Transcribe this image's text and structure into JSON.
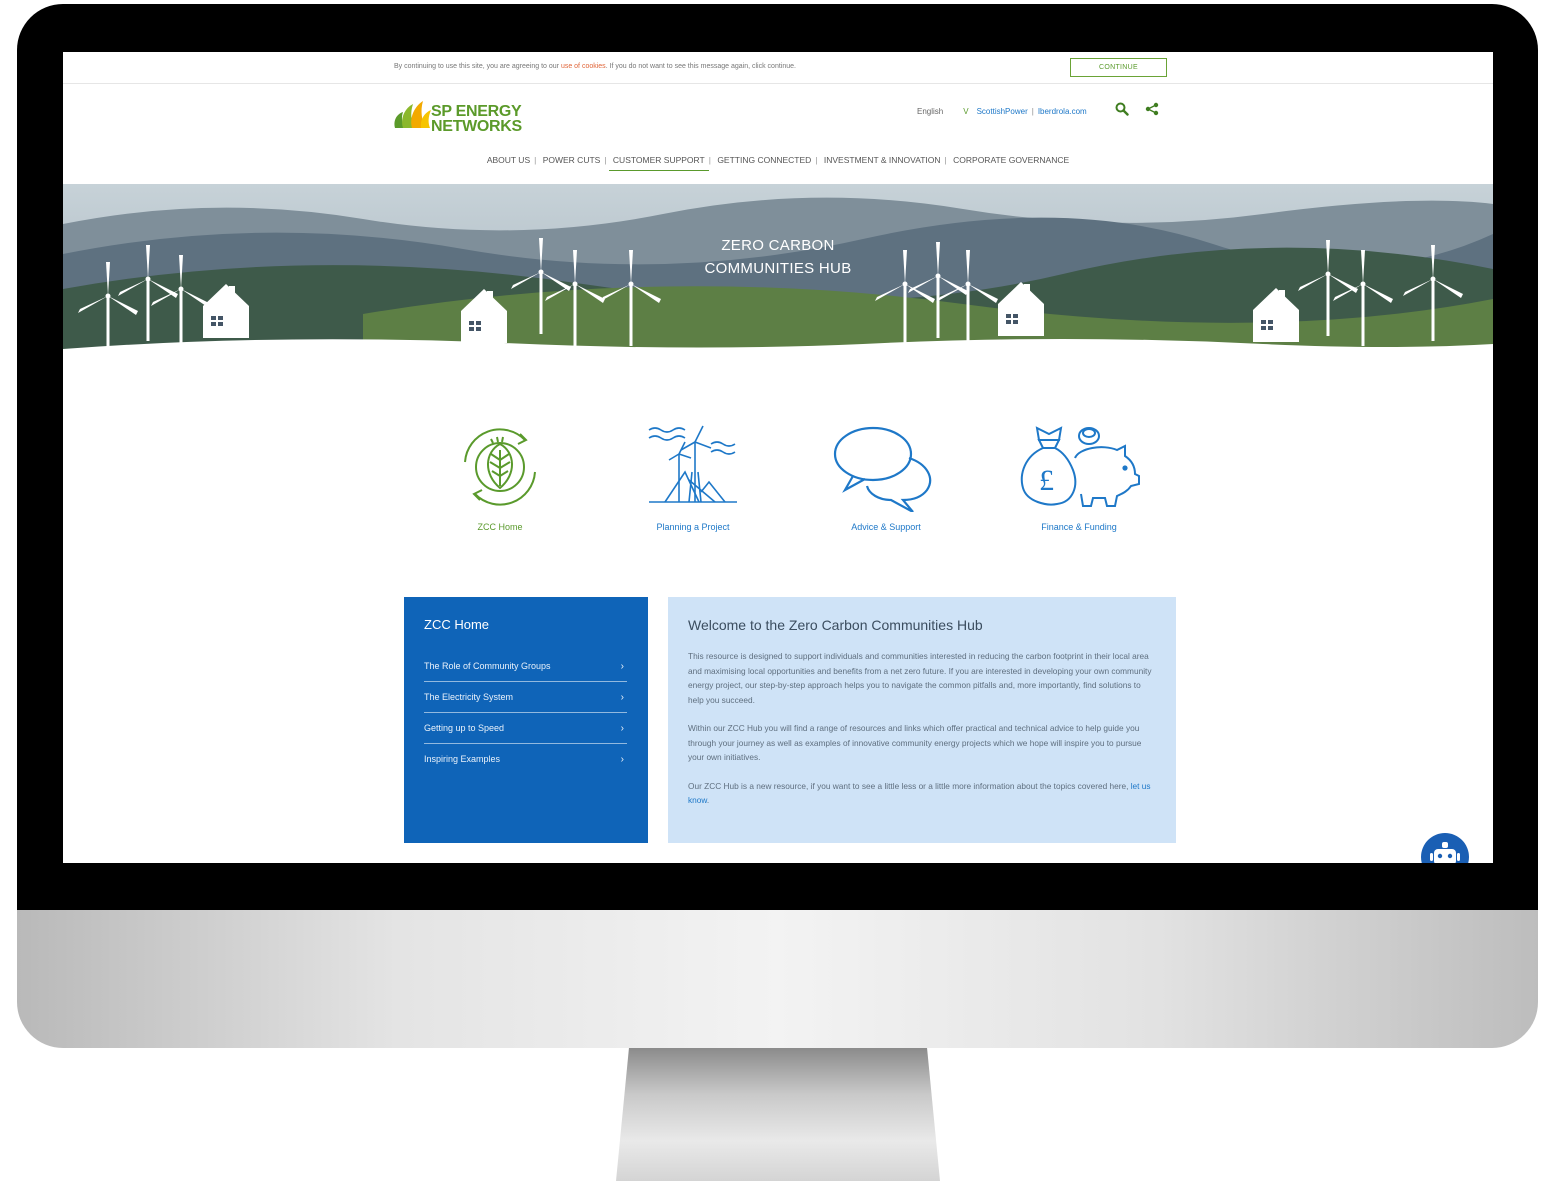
{
  "cookie_bar": {
    "text_before": "By continuing to use this site, you are agreeing to our ",
    "link_text": "use of cookies",
    "text_after": ". If you do not want to see this message again, click continue.",
    "button_label": "CONTINUE"
  },
  "header": {
    "logo_line1": "SP ENERGY",
    "logo_line2": "NETWORKS",
    "language": "English",
    "chevron": "V",
    "link1": "ScottishPower",
    "separator": "|",
    "link2": "Iberdrola.com",
    "icons": [
      "search-icon",
      "share-icon"
    ]
  },
  "nav": {
    "items": [
      {
        "label": "ABOUT US"
      },
      {
        "label": "POWER CUTS"
      },
      {
        "label": "CUSTOMER SUPPORT"
      },
      {
        "label": "GETTING CONNECTED"
      },
      {
        "label": "INVESTMENT & INNOVATION"
      },
      {
        "label": "CORPORATE GOVERNANCE"
      }
    ],
    "active": "CUSTOMER SUPPORT"
  },
  "hero": {
    "title_line1": "ZERO CARBON",
    "title_line2": "COMMUNITIES HUB"
  },
  "tiles": [
    {
      "label": "ZCC Home",
      "icon": "leaf-recycle-icon",
      "color": "#5a9a2c"
    },
    {
      "label": "Planning a Project",
      "icon": "wind-turbine-icon",
      "color": "#1e78c8"
    },
    {
      "label": "Advice & Support",
      "icon": "speech-bubbles-icon",
      "color": "#1e78c8"
    },
    {
      "label": "Finance & Funding",
      "icon": "money-bag-piggy-icon",
      "color": "#1e78c8"
    }
  ],
  "side_menu": {
    "title": "ZCC Home",
    "items": [
      {
        "label": "The Role of Community Groups",
        "chevron": "›"
      },
      {
        "label": "The Electricity System",
        "chevron": "›"
      },
      {
        "label": "Getting up to Speed",
        "chevron": "›"
      },
      {
        "label": "Inspiring Examples",
        "chevron": "›"
      }
    ]
  },
  "welcome": {
    "title": "Welcome to the Zero Carbon Communities Hub",
    "para1": "This resource is designed to support individuals and communities interested in reducing the carbon footprint in their local area and maximising local opportunities and benefits from a net zero future. If you are interested in developing your own community energy project, our step-by-step approach helps you to navigate the common pitfalls and, more importantly, find solutions to help you succeed.",
    "para2": "Within our ZCC Hub you will find a range of resources and links which offer practical and technical advice to help guide you through your journey as well as examples of innovative community energy projects which we hope will inspire you to pursue your own initiatives.",
    "para3_before": "Our ZCC Hub is a new resource, if you want to see a little less or a little more information about the topics covered here, ",
    "para3_link": "let us know",
    "para3_after": "."
  },
  "chatbot": {
    "icon": "robot-chat-icon"
  },
  "colors": {
    "brand_green": "#5a9a2c",
    "brand_blue": "#0f64b8",
    "link_blue": "#1e78c8",
    "panel_light_blue": "#cfe3f7",
    "cookie_link": "#e0663a"
  }
}
